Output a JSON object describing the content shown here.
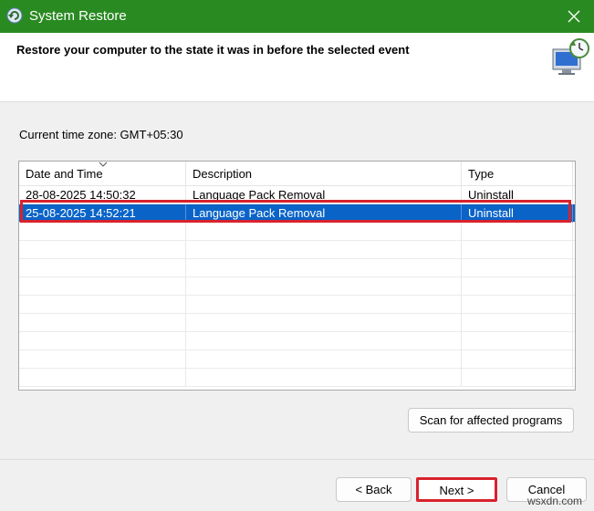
{
  "window": {
    "title": "System Restore",
    "close_icon": "close-icon",
    "app_icon": "system-restore-icon"
  },
  "header": {
    "text": "Restore your computer to the state it was in before the selected event",
    "icon": "system-restore-large-icon"
  },
  "timezone_label": "Current time zone: GMT+05:30",
  "list": {
    "columns": [
      "Date and Time",
      "Description",
      "Type"
    ],
    "sort_column": "Date and Time",
    "rows": [
      {
        "date": "28-08-2025 14:50:32",
        "description": "Language Pack Removal",
        "type": "Uninstall",
        "selected": false
      },
      {
        "date": "25-08-2025 14:52:21",
        "description": "Language Pack Removal",
        "type": "Uninstall",
        "selected": true
      }
    ]
  },
  "buttons": {
    "scan": "Scan for affected programs",
    "back": "< Back",
    "next": "Next >",
    "cancel": "Cancel"
  },
  "watermark": "wsxdn.com",
  "colors": {
    "titlebar": "#2a8a22",
    "selection": "#0a64c8",
    "highlight_outline": "#d8222e"
  }
}
